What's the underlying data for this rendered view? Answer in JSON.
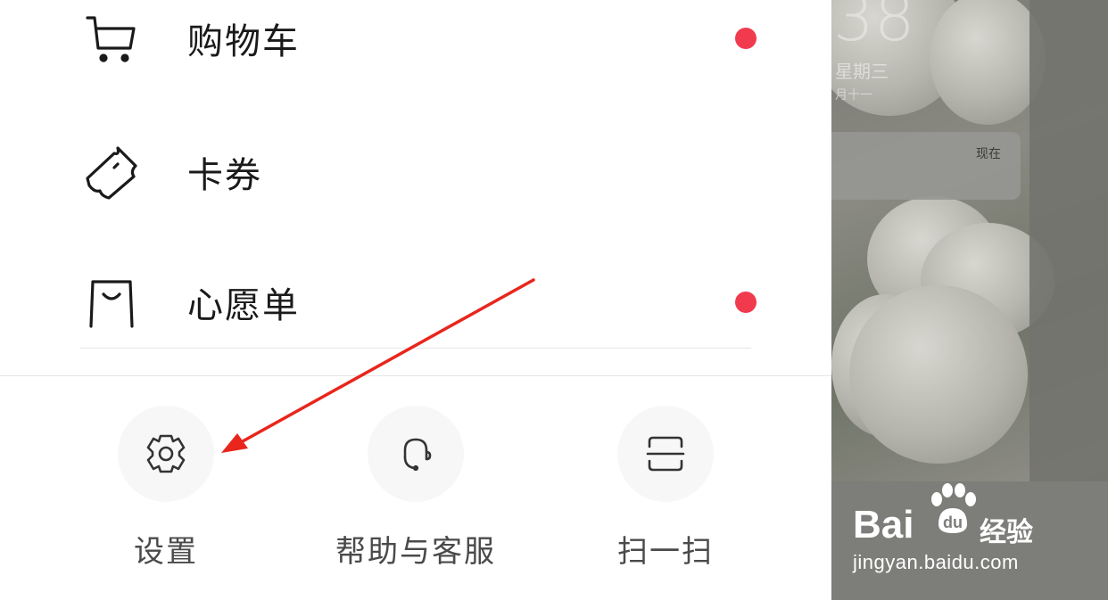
{
  "menu": {
    "items": [
      {
        "label": "购物车",
        "icon": "cart-icon",
        "has_dot": true
      },
      {
        "label": "卡券",
        "icon": "coupon-icon",
        "has_dot": false
      },
      {
        "label": "心愿单",
        "icon": "wishlist-bag-icon",
        "has_dot": true
      }
    ],
    "dot_color": "#f23a4f"
  },
  "actions": [
    {
      "label": "设置",
      "icon": "gear-icon"
    },
    {
      "label": "帮助与客服",
      "icon": "headset-icon"
    },
    {
      "label": "扫一扫",
      "icon": "scan-icon"
    }
  ],
  "background": {
    "clock": "38",
    "weekday": "星期三",
    "lunar": "月十一",
    "notification_time": "现在"
  },
  "watermark": {
    "brand": "Bai",
    "brand_cn": "经验",
    "url": "jingyan.baidu.com"
  },
  "annotation_color": "#e8261c"
}
